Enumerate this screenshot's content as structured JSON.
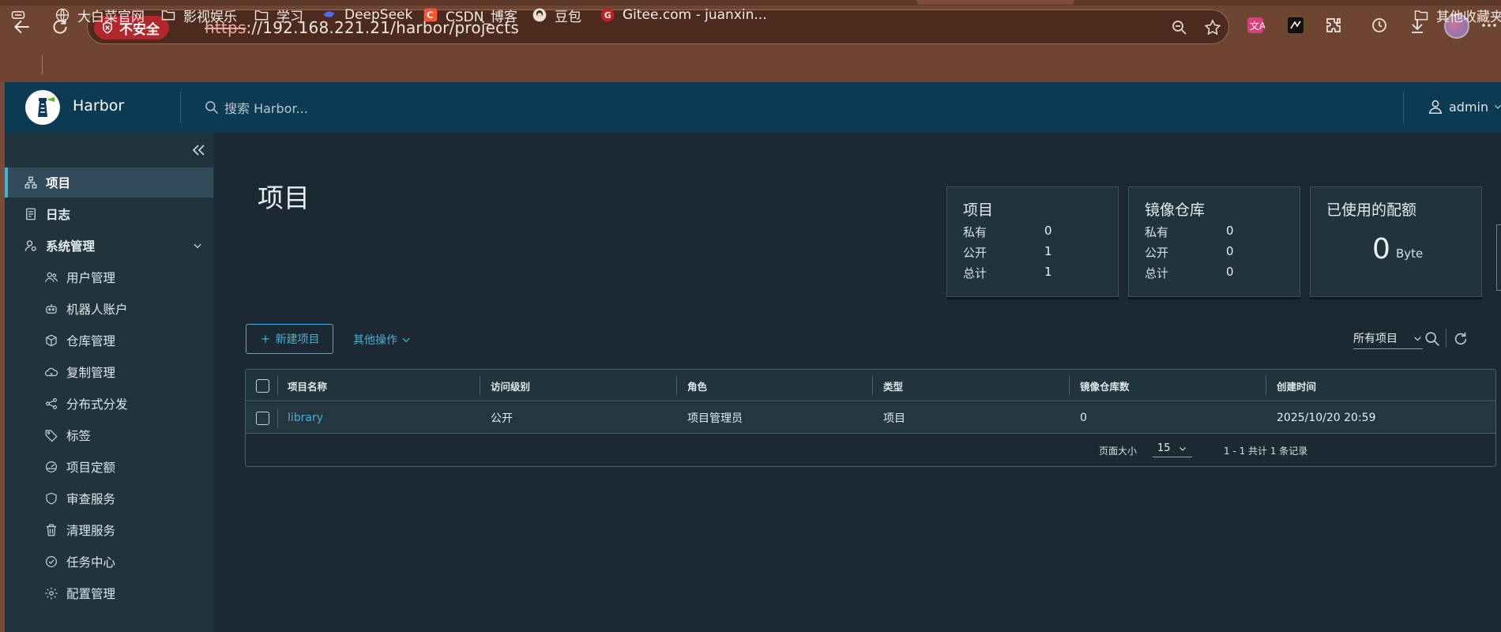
{
  "browser": {
    "security_label": "不安全",
    "url_scheme": "https",
    "url_rest": "://192.168.221.21/harbor/projects",
    "bookmarks": [
      {
        "label": "大白菜官网",
        "icon": "globe-icon"
      },
      {
        "label": "影视娱乐",
        "icon": "folder-icon"
      },
      {
        "label": "学习",
        "icon": "folder-icon"
      },
      {
        "label": "DeepSeek",
        "icon": "deepseek-icon"
      },
      {
        "label": "CSDN_博客",
        "icon": "csdn-icon"
      },
      {
        "label": "豆包",
        "icon": "doubao-icon"
      },
      {
        "label": "Gitee.com - juanxin...",
        "icon": "gitee-icon"
      }
    ],
    "other_bookmarks": "其他收藏夹"
  },
  "header": {
    "brand": "Harbor",
    "search_placeholder": "搜索 Harbor...",
    "user": "admin"
  },
  "sidebar": {
    "items": [
      {
        "label": "项目",
        "icon": "projects-icon",
        "active": true
      },
      {
        "label": "日志",
        "icon": "logs-icon"
      },
      {
        "label": "系统管理",
        "icon": "admin-icon",
        "expanded": true
      }
    ],
    "sub_items": [
      {
        "label": "用户管理",
        "icon": "users-icon"
      },
      {
        "label": "机器人账户",
        "icon": "robot-icon"
      },
      {
        "label": "仓库管理",
        "icon": "registry-icon"
      },
      {
        "label": "复制管理",
        "icon": "replication-icon"
      },
      {
        "label": "分布式分发",
        "icon": "distribution-icon"
      },
      {
        "label": "标签",
        "icon": "tag-icon"
      },
      {
        "label": "项目定额",
        "icon": "quota-icon"
      },
      {
        "label": "审查服务",
        "icon": "shield-icon"
      },
      {
        "label": "清理服务",
        "icon": "trash-icon"
      },
      {
        "label": "任务中心",
        "icon": "task-icon"
      },
      {
        "label": "配置管理",
        "icon": "settings-icon"
      }
    ]
  },
  "main": {
    "title": "项目",
    "cards": {
      "projects": {
        "title": "项目",
        "private_label": "私有",
        "private": "0",
        "public_label": "公开",
        "public": "1",
        "total_label": "总计",
        "total": "1"
      },
      "repos": {
        "title": "镜像仓库",
        "private_label": "私有",
        "private": "0",
        "public_label": "公开",
        "public": "0",
        "total_label": "总计",
        "total": "0"
      },
      "quota": {
        "title": "已使用的配额",
        "value": "0",
        "unit": "Byte"
      }
    },
    "new_project": "新建项目",
    "more_actions": "其他操作",
    "filter": "所有项目",
    "columns": [
      "项目名称",
      "访问级别",
      "角色",
      "类型",
      "镜像仓库数",
      "创建时间"
    ],
    "rows": [
      {
        "name": "library",
        "access": "公开",
        "role": "项目管理员",
        "type": "项目",
        "repo_count": "0",
        "created": "2025/10/20 20:59"
      }
    ],
    "page_size_label": "页面大小",
    "page_size": "15",
    "page_count": "1 - 1 共计 1 条记录"
  },
  "colors": {
    "accent": "#49afd9",
    "header": "#0c3a52",
    "sidebar": "#21333d",
    "content": "#1b2a32",
    "insecure": "#b3262c"
  }
}
